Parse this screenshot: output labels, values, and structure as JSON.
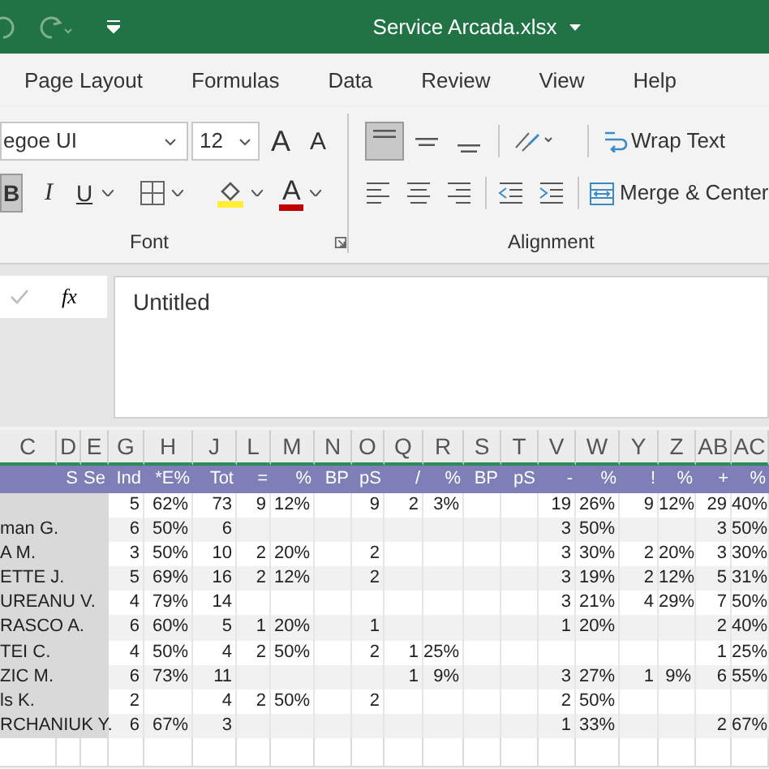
{
  "title_bar": {
    "title": "Service Arcada.xlsx"
  },
  "ribbon_tabs": [
    "Page Layout",
    "Formulas",
    "Data",
    "Review",
    "View",
    "Help"
  ],
  "font_group": {
    "font_name": "egoe UI",
    "font_size": "12",
    "grow": "A",
    "shrink": "A",
    "bold": {
      "label": "B",
      "selected": true
    },
    "italic": {
      "label": "I",
      "selected": false
    },
    "underline": {
      "label": "U",
      "selected": false
    },
    "font_color": "A",
    "label": "Font"
  },
  "alignment_group": {
    "vertical_align": [
      {
        "kind": "top",
        "selected": true
      },
      {
        "kind": "middle",
        "selected": false
      },
      {
        "kind": "bottom",
        "selected": false
      }
    ],
    "wrap_text": "Wrap Text",
    "merge": "Merge & Center",
    "label": "Alignment"
  },
  "formula_bar": {
    "fx": "fx",
    "value": "Untitled"
  },
  "sheet": {
    "columns": [
      "C",
      "D",
      "E",
      "G",
      "H",
      "J",
      "L",
      "M",
      "N",
      "O",
      "Q",
      "R",
      "S",
      "T",
      "V",
      "W",
      "Y",
      "Z",
      "AB",
      "AC"
    ],
    "header": [
      "S",
      "Se",
      "Ind",
      "*E%",
      "Tot",
      "=",
      "%",
      "BP",
      "pS",
      "/",
      "%",
      "BP",
      "pS",
      "-",
      "%",
      "!",
      "%",
      "+",
      "%"
    ],
    "rows": [
      {
        "cells": [
          "",
          "",
          "",
          "5",
          "62%",
          "73",
          "9",
          "12%",
          "",
          "9",
          "2",
          "3%",
          "",
          "",
          "19",
          "26%",
          "9",
          "12%",
          "29",
          "40%"
        ]
      },
      {
        "cells": [
          "man G.",
          "",
          "",
          "6",
          "50%",
          "6",
          "",
          "",
          "",
          "",
          "",
          "",
          "",
          "",
          "3",
          "50%",
          "",
          "",
          "3",
          "50%"
        ]
      },
      {
        "cells": [
          "A M.",
          "",
          "",
          "3",
          "50%",
          "10",
          "2",
          "20%",
          "",
          "2",
          "",
          "",
          "",
          "",
          "3",
          "30%",
          "2",
          "20%",
          "3",
          "30%"
        ]
      },
      {
        "cells": [
          "ETTE J.",
          "",
          "",
          "5",
          "69%",
          "16",
          "2",
          "12%",
          "",
          "2",
          "",
          "",
          "",
          "",
          "3",
          "19%",
          "2",
          "12%",
          "5",
          "31%"
        ]
      },
      {
        "cells": [
          "UREANU V.",
          "",
          "",
          "4",
          "79%",
          "14",
          "",
          "",
          "",
          "",
          "",
          "",
          "",
          "",
          "3",
          "21%",
          "4",
          "29%",
          "7",
          "50%"
        ]
      },
      {
        "cells": [
          "RASCO A.",
          "",
          "",
          "6",
          "60%",
          "5",
          "1",
          "20%",
          "",
          "1",
          "",
          "",
          "",
          "",
          "1",
          "20%",
          "",
          "",
          "2",
          "40%"
        ]
      },
      {
        "cells": [
          "TEI C.",
          "",
          "",
          "4",
          "50%",
          "4",
          "2",
          "50%",
          "",
          "2",
          "1",
          "25%",
          "",
          "",
          "",
          "",
          "",
          "",
          "1",
          "25%"
        ]
      },
      {
        "cells": [
          "ZIC M.",
          "",
          "",
          "6",
          "73%",
          "11",
          "",
          "",
          "",
          "",
          "1",
          "9%",
          "",
          "",
          "3",
          "27%",
          "1",
          "9%",
          "6",
          "55%"
        ]
      },
      {
        "cells": [
          "ls K.",
          "",
          "",
          "2",
          "",
          "4",
          "2",
          "50%",
          "",
          "2",
          "",
          "",
          "",
          "",
          "2",
          "50%",
          "",
          "",
          "",
          ""
        ]
      },
      {
        "cells": [
          "RCHANIUK Y.",
          "",
          "",
          "6",
          "67%",
          "3",
          "",
          "",
          "",
          "",
          "",
          "",
          "",
          "",
          "1",
          "33%",
          "",
          "",
          "2",
          "67%"
        ]
      }
    ]
  }
}
